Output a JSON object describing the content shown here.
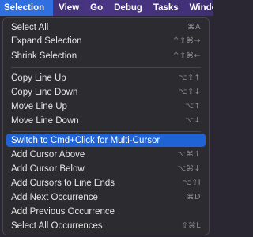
{
  "menubar": {
    "items": [
      {
        "label": "Selection",
        "active": true
      },
      {
        "label": "View"
      },
      {
        "label": "Go"
      },
      {
        "label": "Debug"
      },
      {
        "label": "Tasks"
      },
      {
        "label": "Windo"
      }
    ]
  },
  "menu": {
    "items": [
      {
        "label": "Select All",
        "shortcut": "⌘A"
      },
      {
        "label": "Expand Selection",
        "shortcut": "^⇧⌘→"
      },
      {
        "label": "Shrink Selection",
        "shortcut": "^⇧⌘←"
      },
      {
        "label": "Copy Line Up",
        "shortcut": "⌥⇧↑"
      },
      {
        "label": "Copy Line Down",
        "shortcut": "⌥⇧↓"
      },
      {
        "label": "Move Line Up",
        "shortcut": "⌥↑"
      },
      {
        "label": "Move Line Down",
        "shortcut": "⌥↓"
      },
      {
        "label": "Switch to Cmd+Click for Multi-Cursor",
        "shortcut": ""
      },
      {
        "label": "Add Cursor Above",
        "shortcut": "⌥⌘↑"
      },
      {
        "label": "Add Cursor Below",
        "shortcut": "⌥⌘↓"
      },
      {
        "label": "Add Cursors to Line Ends",
        "shortcut": "⌥⇧I"
      },
      {
        "label": "Add Next Occurrence",
        "shortcut": "⌘D"
      },
      {
        "label": "Add Previous Occurrence",
        "shortcut": ""
      },
      {
        "label": "Select All Occurrences",
        "shortcut": "⇧⌘L"
      }
    ]
  }
}
